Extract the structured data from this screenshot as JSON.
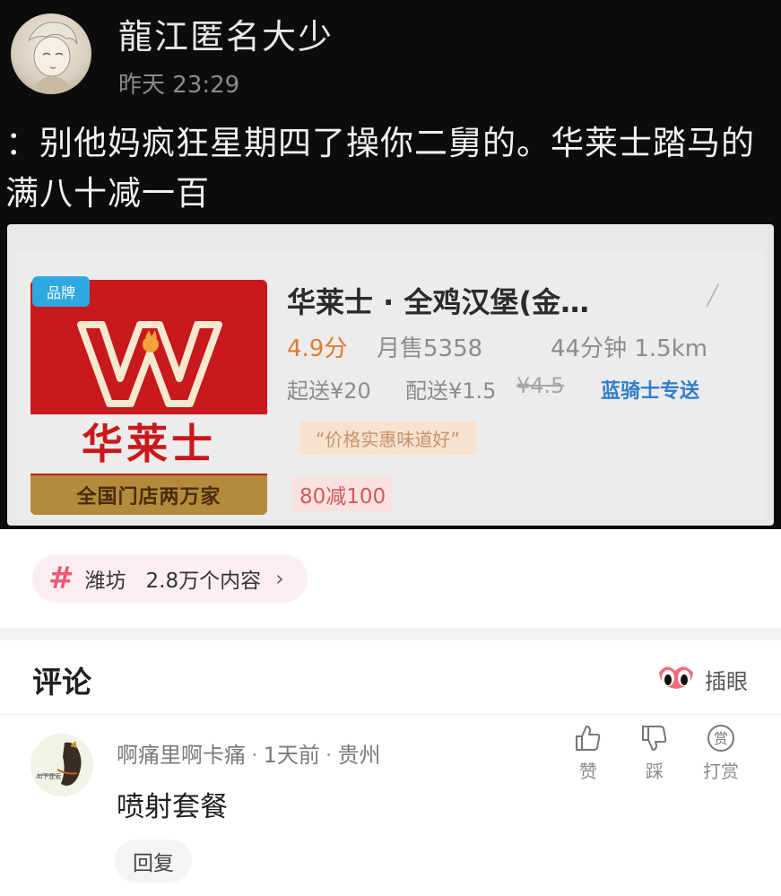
{
  "post": {
    "author": "龍江匿名大少",
    "time": "昨天 23:29",
    "text": "：别他妈疯狂星期四了操你二舅的。华莱士踏马的满八十减一百"
  },
  "store_card": {
    "brand_tag": "品牌",
    "logo_text": "华莱士",
    "logo_ribbon": "全国门店两万家",
    "title": "华莱士 · 全鸡汉堡(金…",
    "rating": "4.9分",
    "monthly_sales": "月售5358",
    "distance": "44分钟 1.5km",
    "min_order": "起送¥20",
    "delivery_fee": "配送¥1.5",
    "delivery_fee_old": "¥4.5",
    "express": "蓝骑士专送",
    "quote": "“价格实惠味道好”",
    "discount": "80减100"
  },
  "topic": {
    "name": "潍坊",
    "count": "2.8万个内容",
    "chevron": "›"
  },
  "comments": {
    "title": "评论",
    "eyes_label": "插眼",
    "items": [
      {
        "user": "啊痛里啊卡痛",
        "time": "1天前",
        "location": "贵州",
        "text": "喷射套餐",
        "reply_label": "回复",
        "actions": {
          "like": "赞",
          "dislike": "踩",
          "reward": "打赏",
          "reward_glyph": "赏"
        }
      }
    ]
  }
}
